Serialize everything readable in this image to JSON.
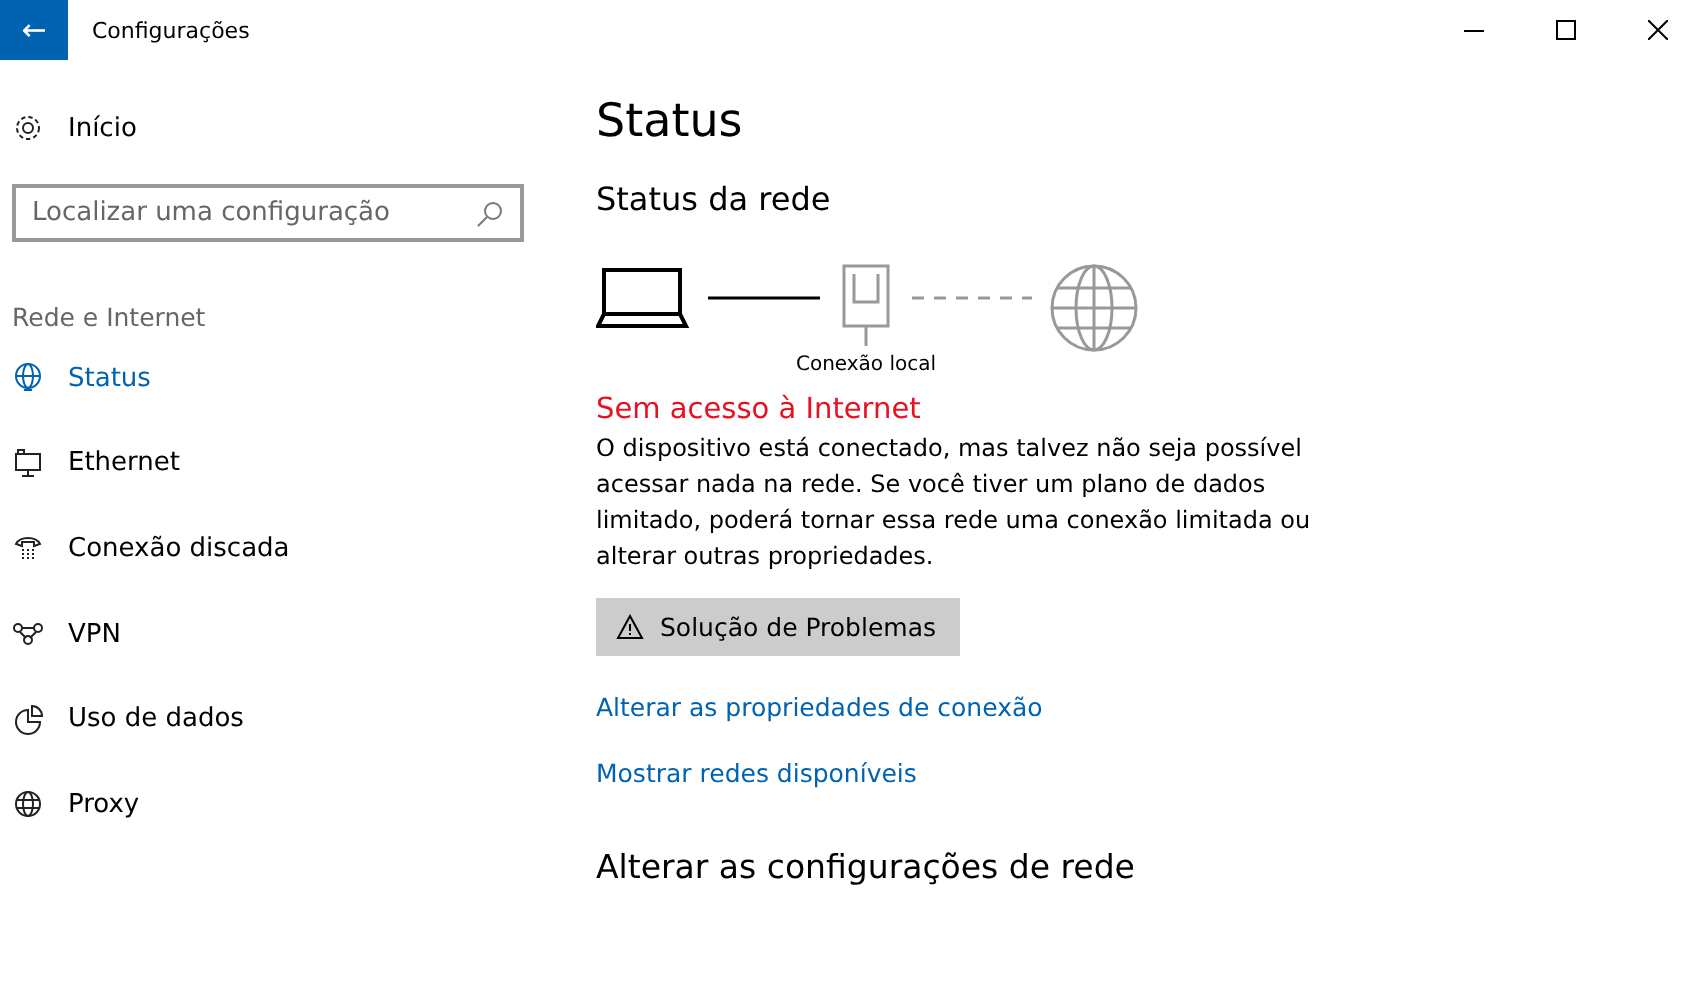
{
  "window": {
    "title": "Configurações",
    "back_button": "←"
  },
  "sidebar": {
    "home": "Início",
    "search": {
      "placeholder": "Localizar uma configuração"
    },
    "section": "Rede e Internet",
    "items": [
      {
        "label": "Status",
        "selected": true
      },
      {
        "label": "Ethernet",
        "selected": false
      },
      {
        "label": "Conexão discada",
        "selected": false
      },
      {
        "label": "VPN",
        "selected": false
      },
      {
        "label": "Uso de dados",
        "selected": false
      },
      {
        "label": "Proxy",
        "selected": false
      }
    ]
  },
  "main": {
    "title": "Status",
    "network_status": {
      "heading": "Status da rede",
      "diagram_label": "Conexão local",
      "connected_to_internet": false
    },
    "alert": "Sem acesso à Internet",
    "description": "O dispositivo está conectado, mas talvez não seja possível acessar nada na rede. Se você tiver um plano de dados limitado, poderá tornar essa rede uma conexão limitada ou alterar outras propriedades.",
    "troubleshoot_button": "Solução de Problemas",
    "links": [
      "Alterar as propriedades de conexão",
      "Mostrar redes disponíveis"
    ],
    "section2": "Alterar as configurações de rede"
  }
}
